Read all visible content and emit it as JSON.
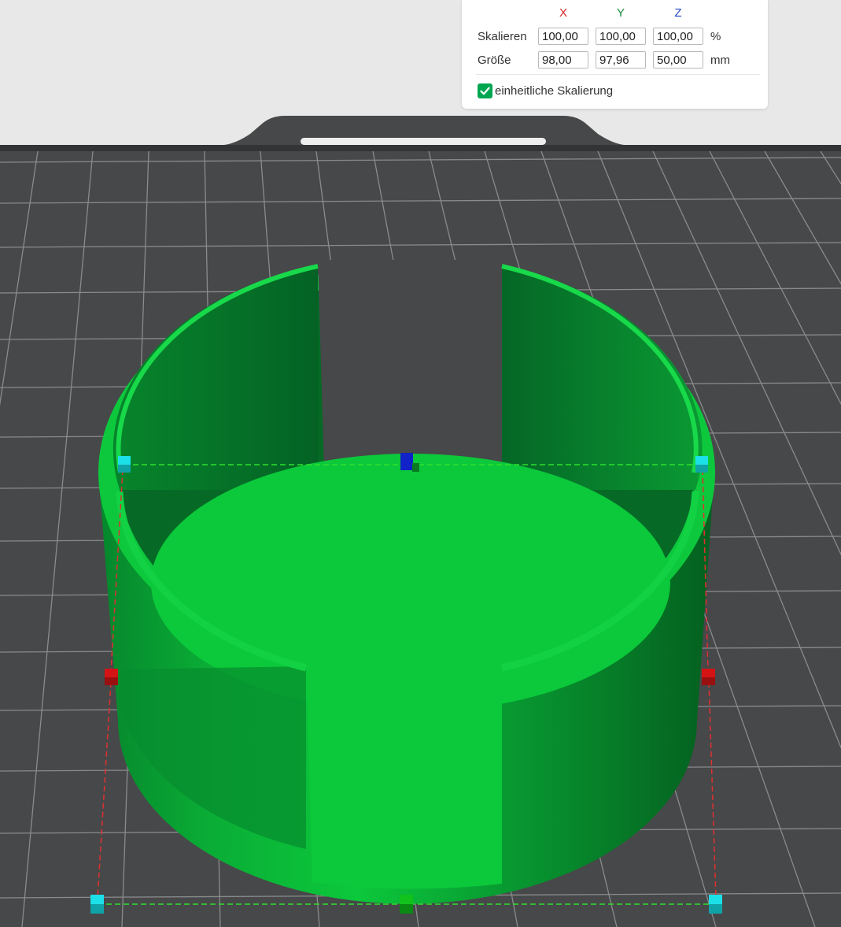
{
  "scale_panel": {
    "axes": [
      {
        "label": "X",
        "color": "#d42a2a"
      },
      {
        "label": "Y",
        "color": "#1b8a3c"
      },
      {
        "label": "Z",
        "color": "#2246c8"
      }
    ],
    "scale": {
      "label": "Skalieren",
      "x": "100,00",
      "y": "100,00",
      "z": "100,00",
      "unit": "%"
    },
    "size": {
      "label": "Größe",
      "x": "98,00",
      "y": "97,96",
      "z": "50,00",
      "unit": "mm"
    },
    "uniform_scaling": {
      "label": "einheitliche Skalierung",
      "checked": true
    }
  },
  "colors": {
    "bed": "#474849",
    "grid": "#8a8b8d",
    "plate_rim": "#333436",
    "model_light": "#0cc93b",
    "model_mid": "#09a634",
    "model_dark": "#045f1f",
    "bounding_box_line": "#2ee02e",
    "height_line": "#e03030",
    "handle_corner": "#1ce0e8",
    "handle_mid": "#d41414",
    "handle_top": "#1022c8",
    "handle_bottom": "#11c21c",
    "accent": "#00a650"
  }
}
